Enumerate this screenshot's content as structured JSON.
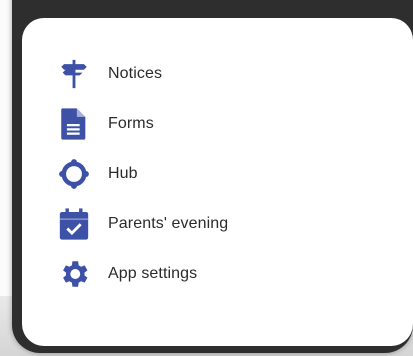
{
  "accent_color": "#3d52a6",
  "menu": {
    "items": [
      {
        "label": "Notices",
        "icon": "signpost-icon"
      },
      {
        "label": "Forms",
        "icon": "document-icon"
      },
      {
        "label": "Hub",
        "icon": "hub-ring-icon"
      },
      {
        "label": "Parents' evening",
        "icon": "calendar-check-icon"
      },
      {
        "label": "App settings",
        "icon": "gear-icon"
      }
    ]
  }
}
